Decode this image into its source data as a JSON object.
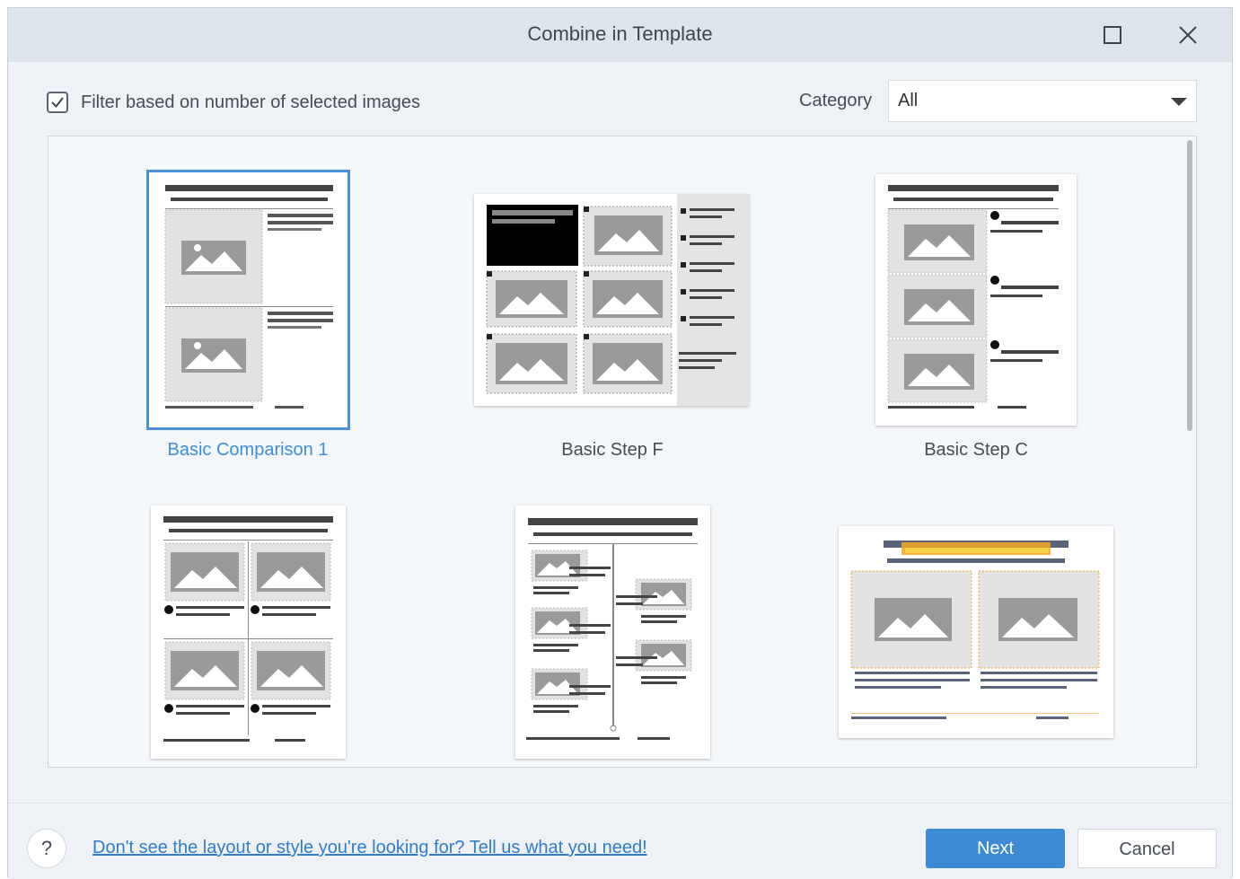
{
  "window": {
    "title": "Combine in Template",
    "maximize_icon": "maximize-icon",
    "close_icon": "close-icon"
  },
  "filter": {
    "checked": true,
    "label": "Filter based on number of selected images"
  },
  "category": {
    "label": "Category",
    "value": "All"
  },
  "templates": [
    {
      "name": "Basic Comparison 1",
      "selected": true
    },
    {
      "name": "Basic Step F",
      "selected": false
    },
    {
      "name": "Basic Step C",
      "selected": false
    },
    {
      "name": "",
      "selected": false
    },
    {
      "name": "",
      "selected": false
    },
    {
      "name": "",
      "selected": false
    }
  ],
  "footer": {
    "help_symbol": "?",
    "help_link": "Don't see the layout or style you're looking for? Tell us what you need!",
    "next_label": "Next",
    "cancel_label": "Cancel"
  },
  "colors": {
    "accent": "#3d8ad5",
    "selected_caption": "#3b8fd9",
    "placeholder_gray": "#9a9a9a",
    "highlight_orange": "#f5a623"
  }
}
